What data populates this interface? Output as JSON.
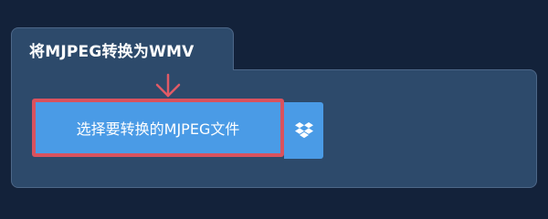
{
  "converter": {
    "title": "将MJPEG转换为WMV",
    "upload_button_label": "选择要转换的MJPEG文件",
    "dropbox_icon": "dropbox-icon",
    "arrow_icon": "down-arrow-icon"
  },
  "colors": {
    "page_background": "#13223a",
    "panel_background": "#2d4a6b",
    "panel_border": "#4d6788",
    "button_background": "#4a9be6",
    "highlight_border": "#d9525e",
    "arrow": "#e05a66",
    "text": "#ffffff"
  }
}
